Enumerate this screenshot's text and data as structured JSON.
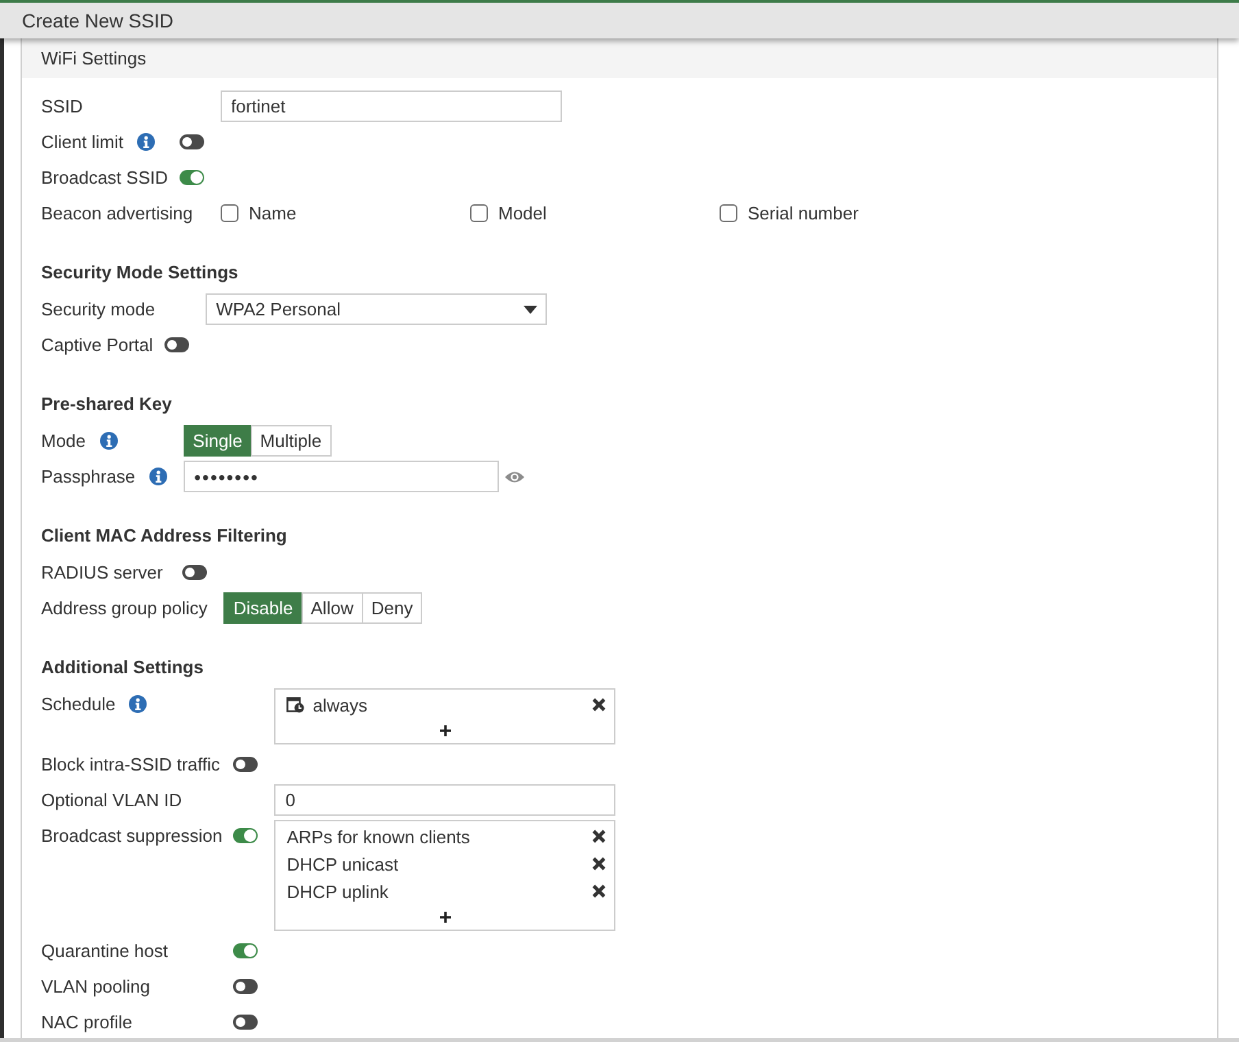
{
  "window": {
    "title": "Create New SSID"
  },
  "sections": [
    {
      "title": "WiFi Settings",
      "kind": "band",
      "rows": [
        {
          "label": "SSID",
          "kind": "text",
          "value": "fortinet"
        },
        {
          "label": "Client limit",
          "kind": "toggle",
          "info": true,
          "on": false
        },
        {
          "label": "Broadcast SSID",
          "kind": "toggle",
          "on": true
        },
        {
          "label": "Beacon advertising",
          "kind": "checkboxes",
          "options": [
            {
              "label": "Name",
              "checked": false
            },
            {
              "label": "Model",
              "checked": false
            },
            {
              "label": "Serial number",
              "checked": false
            }
          ]
        }
      ]
    },
    {
      "title": "Security Mode Settings",
      "kind": "heading",
      "rows": [
        {
          "label": "Security mode",
          "kind": "select",
          "value": "WPA2 Personal"
        },
        {
          "label": "Captive Portal",
          "kind": "toggle",
          "on": false
        }
      ]
    },
    {
      "title": "Pre-shared Key",
      "kind": "heading",
      "rows": [
        {
          "label": "Mode",
          "kind": "segmented",
          "info": true,
          "options": [
            {
              "label": "Single",
              "selected": true
            },
            {
              "label": "Multiple",
              "selected": false
            }
          ]
        },
        {
          "label": "Passphrase",
          "kind": "password",
          "info": true,
          "value": "••••••••"
        }
      ]
    },
    {
      "title": "Client MAC Address Filtering",
      "kind": "heading",
      "rows": [
        {
          "label": "RADIUS server",
          "kind": "toggle",
          "on": false
        },
        {
          "label": "Address group policy",
          "kind": "segmented",
          "options": [
            {
              "label": "Disable",
              "selected": true
            },
            {
              "label": "Allow",
              "selected": false
            },
            {
              "label": "Deny",
              "selected": false
            }
          ]
        }
      ]
    },
    {
      "title": "Additional Settings",
      "kind": "heading",
      "rows": [
        {
          "label": "Schedule",
          "kind": "list",
          "info": true,
          "items": [
            {
              "label": "always",
              "kind": "schedule"
            }
          ]
        },
        {
          "label": "Block intra-SSID traffic",
          "kind": "toggle",
          "on": false
        },
        {
          "label": "Optional VLAN ID",
          "kind": "text",
          "value": "0"
        },
        {
          "label": "Broadcast suppression",
          "kind": "list",
          "on": true,
          "items": [
            {
              "label": "ARPs for known clients",
              "kind": "option"
            },
            {
              "label": "DHCP unicast",
              "kind": "option"
            },
            {
              "label": "DHCP uplink",
              "kind": "option"
            }
          ]
        },
        {
          "label": "Quarantine host",
          "kind": "toggle",
          "on": true
        },
        {
          "label": "VLAN pooling",
          "kind": "toggle",
          "on": false
        },
        {
          "label": "NAC profile",
          "kind": "toggle",
          "on": false
        }
      ]
    }
  ]
}
